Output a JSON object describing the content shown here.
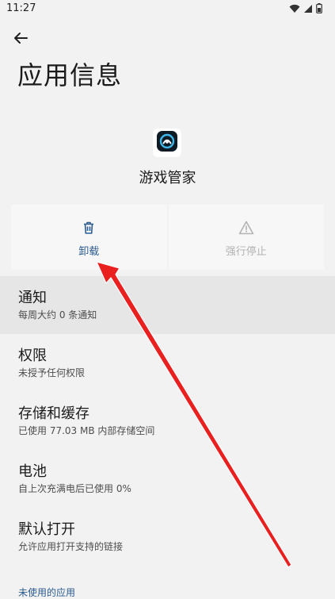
{
  "status_bar": {
    "time": "11:27"
  },
  "header": {
    "title": "应用信息"
  },
  "app": {
    "name": "游戏管家"
  },
  "actions": {
    "uninstall_label": "卸载",
    "force_stop_label": "强行停止"
  },
  "list": [
    {
      "title": "通知",
      "subtitle": "每周大约 0 条通知"
    },
    {
      "title": "权限",
      "subtitle": "未授予任何权限"
    },
    {
      "title": "存储和缓存",
      "subtitle": "已使用 77.03 MB 内部存储空间"
    },
    {
      "title": "电池",
      "subtitle": "自上次充满电后已使用 0%"
    },
    {
      "title": "默认打开",
      "subtitle": "允许应用打开支持的链接"
    }
  ],
  "footer": {
    "section_label": "未使用的应用"
  },
  "colors": {
    "accent": "#2b5b8f",
    "background": "#f2f2f2",
    "annotation_arrow": "#e8201f"
  }
}
